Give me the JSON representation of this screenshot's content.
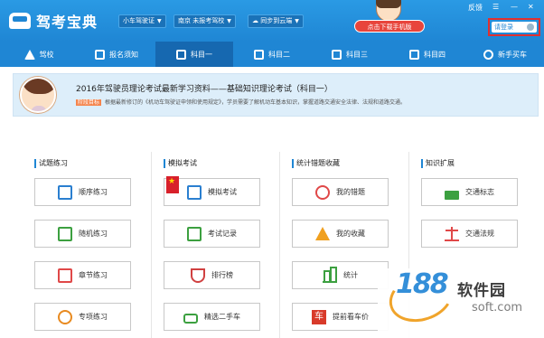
{
  "app": {
    "title": "驾考宝典"
  },
  "header": {
    "license": "小车驾驶证",
    "school": "南京 未报考驾校",
    "sync": "同步到云端",
    "promo": "点击下载手机版",
    "feedback": "反馈",
    "login": "请登录"
  },
  "nav": {
    "items": [
      {
        "label": "驾校"
      },
      {
        "label": "报名须知"
      },
      {
        "label": "科目一"
      },
      {
        "label": "科目二"
      },
      {
        "label": "科目三"
      },
      {
        "label": "科目四"
      },
      {
        "label": "新手买车"
      }
    ]
  },
  "banner": {
    "title": "2016年驾驶员理论考试最新学习资料——基础知识理论考试（科目一）",
    "tag": "阶段目标",
    "desc": "根据最新修订的《机动车驾驶证申领和使用规定》，学员需要了解机动车基本知识，掌握道路交通安全法律、法规和道路交通。"
  },
  "sections": {
    "practice": {
      "title": "试题练习",
      "items": [
        "顺序练习",
        "随机练习",
        "章节练习",
        "专项练习"
      ]
    },
    "exam": {
      "title": "模拟考试",
      "items": [
        "模拟考试",
        "考试记录",
        "排行榜",
        "精选二手车"
      ]
    },
    "stats": {
      "title": "统计错题收藏",
      "items": [
        "我的错题",
        "我的收藏",
        "统计",
        "提前看车价"
      ]
    },
    "knowledge": {
      "title": "知识扩展",
      "items": [
        "交通标志",
        "交通法规"
      ]
    }
  },
  "icon_glyphs": {
    "lock": "🔒"
  },
  "watermark": {
    "number": "188",
    "name": "软件园",
    "url": "soft.com"
  }
}
